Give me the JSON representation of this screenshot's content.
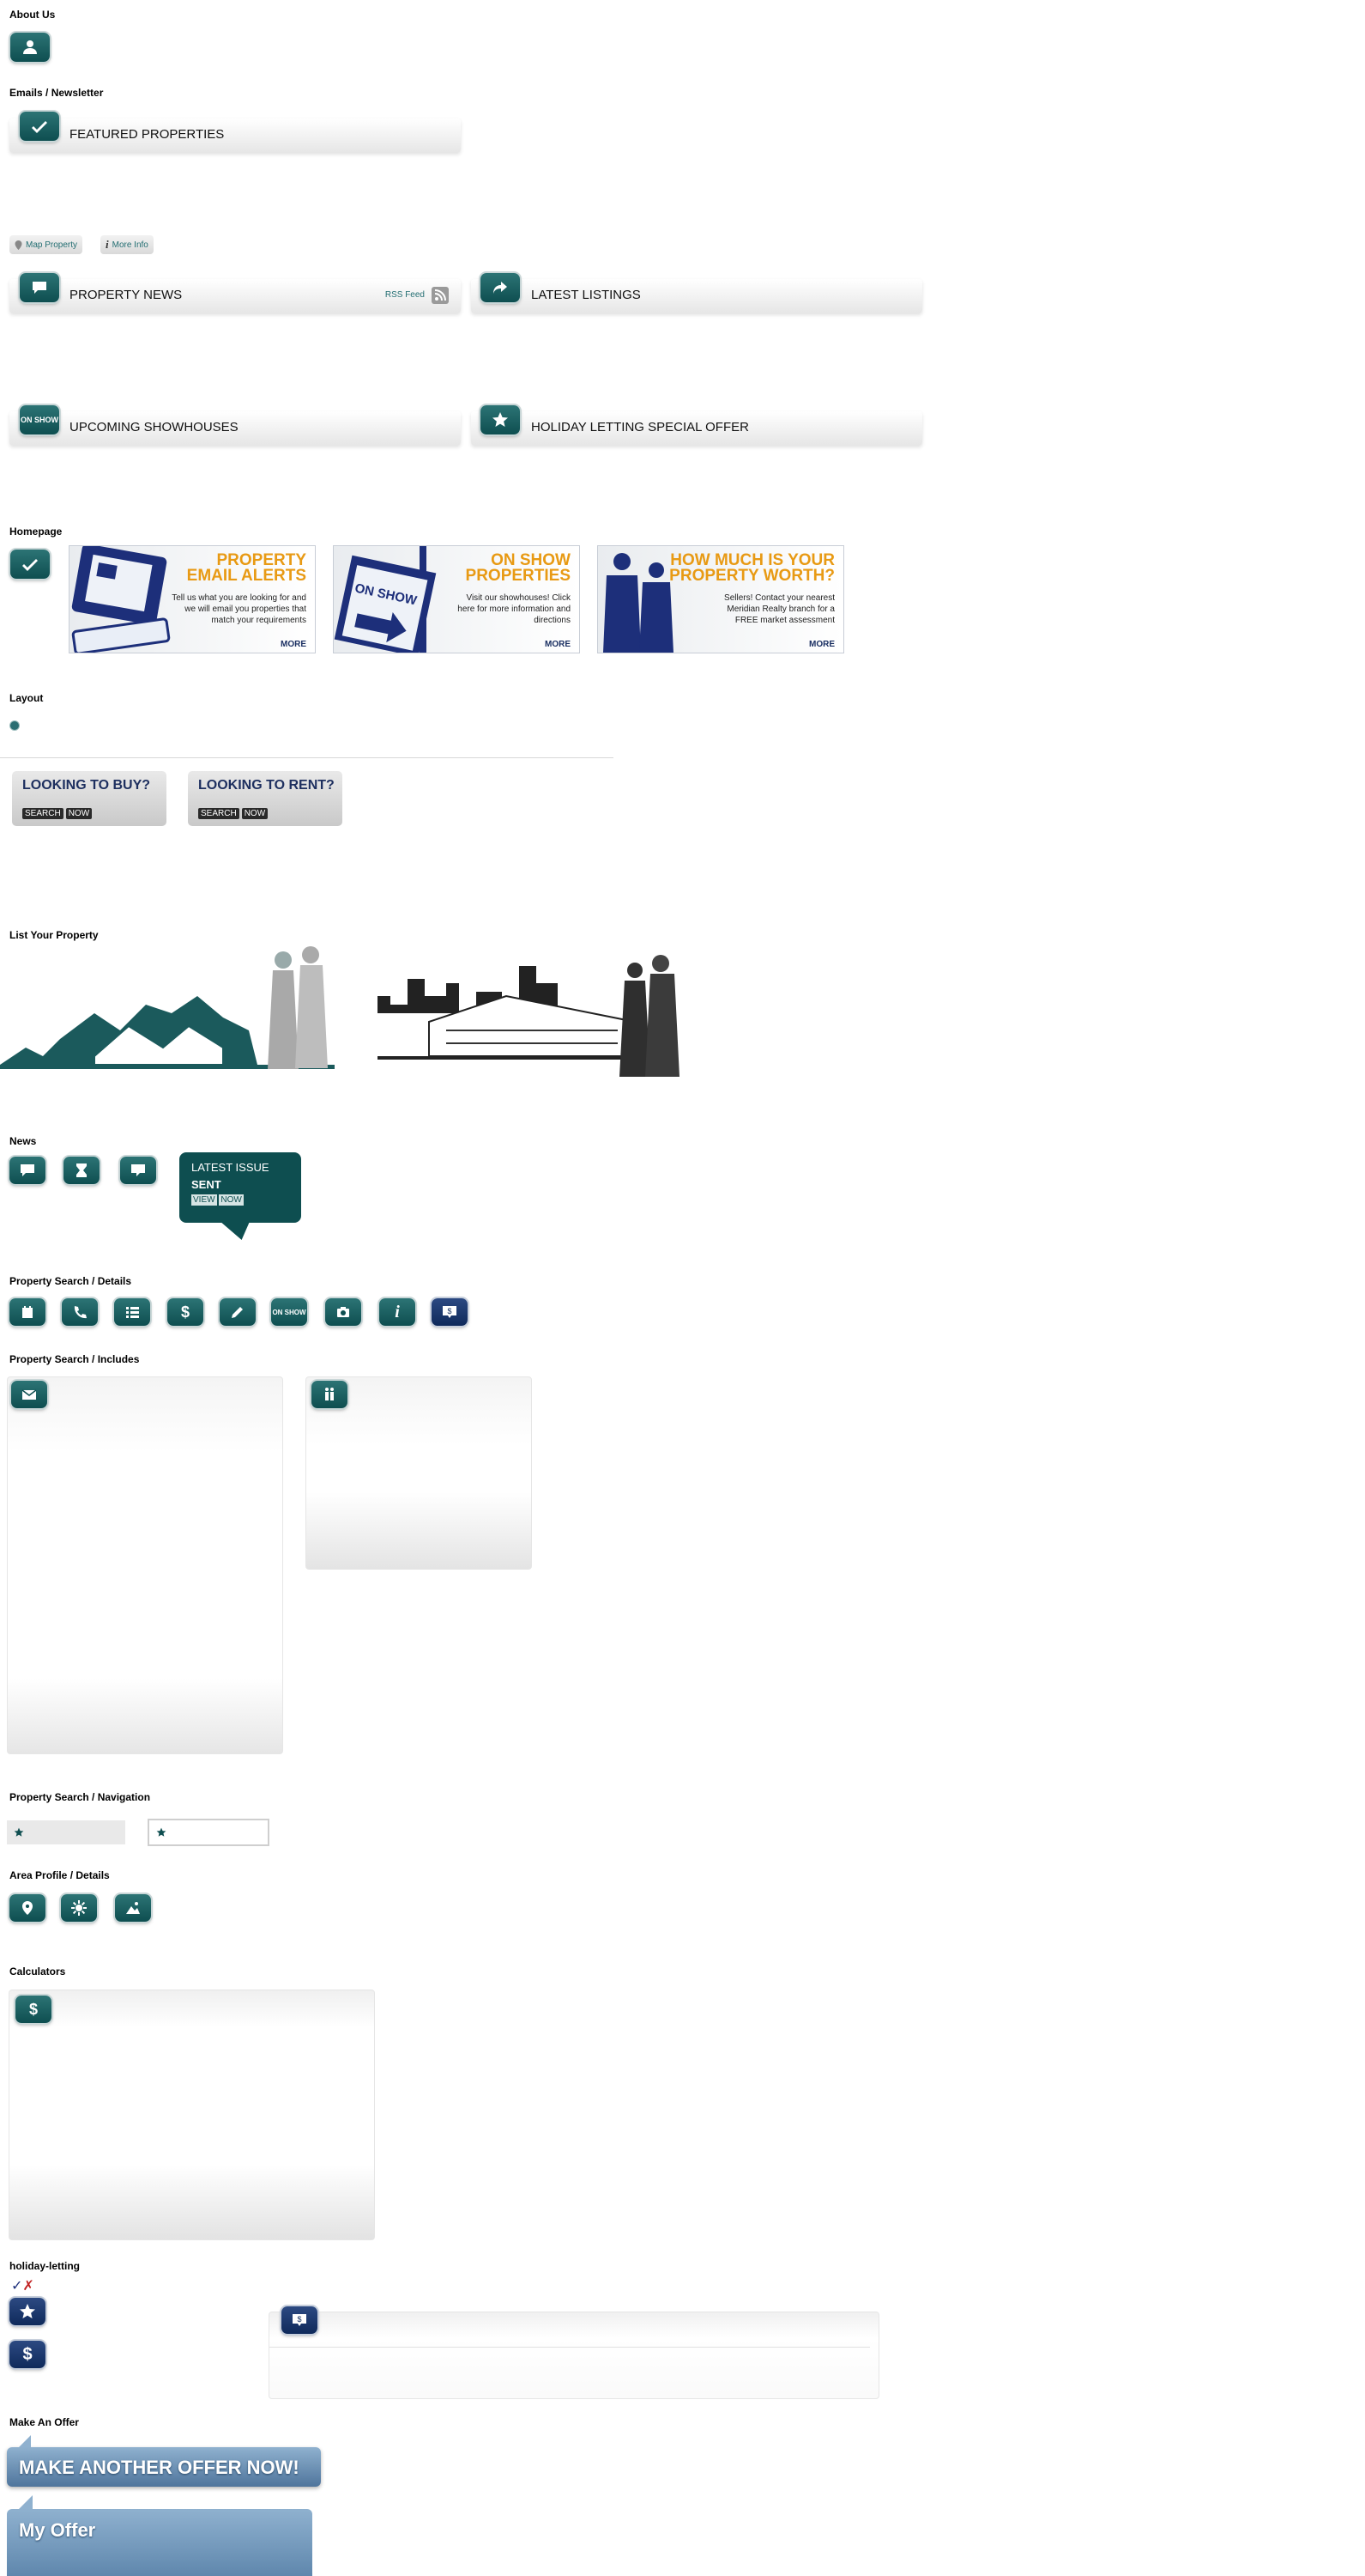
{
  "sections": {
    "about_us": "About Us",
    "emails_newsletter": "Emails / Newsletter",
    "homepage": "Homepage",
    "layout": "Layout",
    "list_property": "List Your Property",
    "news": "News",
    "search_details": "Property Search / Details",
    "search_includes": "Property Search / Includes",
    "search_navigation": "Property Search / Navigation",
    "area_profile": "Area Profile / Details",
    "calculators": "Calculators",
    "holiday_letting": "holiday-letting",
    "make_offer": "Make An Offer"
  },
  "bars": {
    "featured": "FEATURED PROPERTIES",
    "news": "PROPERTY NEWS",
    "rss": "RSS Feed",
    "latest": "LATEST LISTINGS",
    "showhouses": "UPCOMING SHOWHOUSES",
    "holiday": "HOLIDAY LETTING SPECIAL OFFER"
  },
  "pills": {
    "map": "Map Property",
    "info": "More Info"
  },
  "on_show_icon": "ON SHOW",
  "tiles": [
    {
      "title1": "PROPERTY",
      "title2": "EMAIL ALERTS",
      "text": "Tell us what you are looking for and we will email you properties that match your requirements",
      "more": "MORE"
    },
    {
      "title1": "ON SHOW",
      "title2": "PROPERTIES",
      "text": "Visit our showhouses! Click here for more information and directions",
      "more": "MORE"
    },
    {
      "title1": "HOW MUCH IS YOUR",
      "title2": "PROPERTY WORTH?",
      "text": "Sellers! Contact your nearest Meridian Realty branch for a FREE market assessment",
      "more": "MORE"
    }
  ],
  "signs": {
    "on_show": "ON SHOW"
  },
  "looking": [
    {
      "title": "LOOKING TO BUY?",
      "s1": "SEARCH",
      "s2": "NOW"
    },
    {
      "title": "LOOKING TO RENT?",
      "s1": "SEARCH",
      "s2": "NOW"
    }
  ],
  "latest_issue": {
    "l1": "LATEST ISSUE",
    "l2": "SENT",
    "v1": "VIEW",
    "v2": "NOW"
  },
  "checkmarks": {
    "tick": "✓",
    "cross": "✗"
  },
  "offer": {
    "again": "MAKE ANOTHER OFFER NOW!",
    "mine": "My Offer"
  },
  "colors": {
    "teal": "#0e4e50",
    "orange": "#e89a14",
    "navy": "#1d2f5f",
    "offer_blue": "#5f87ad"
  }
}
